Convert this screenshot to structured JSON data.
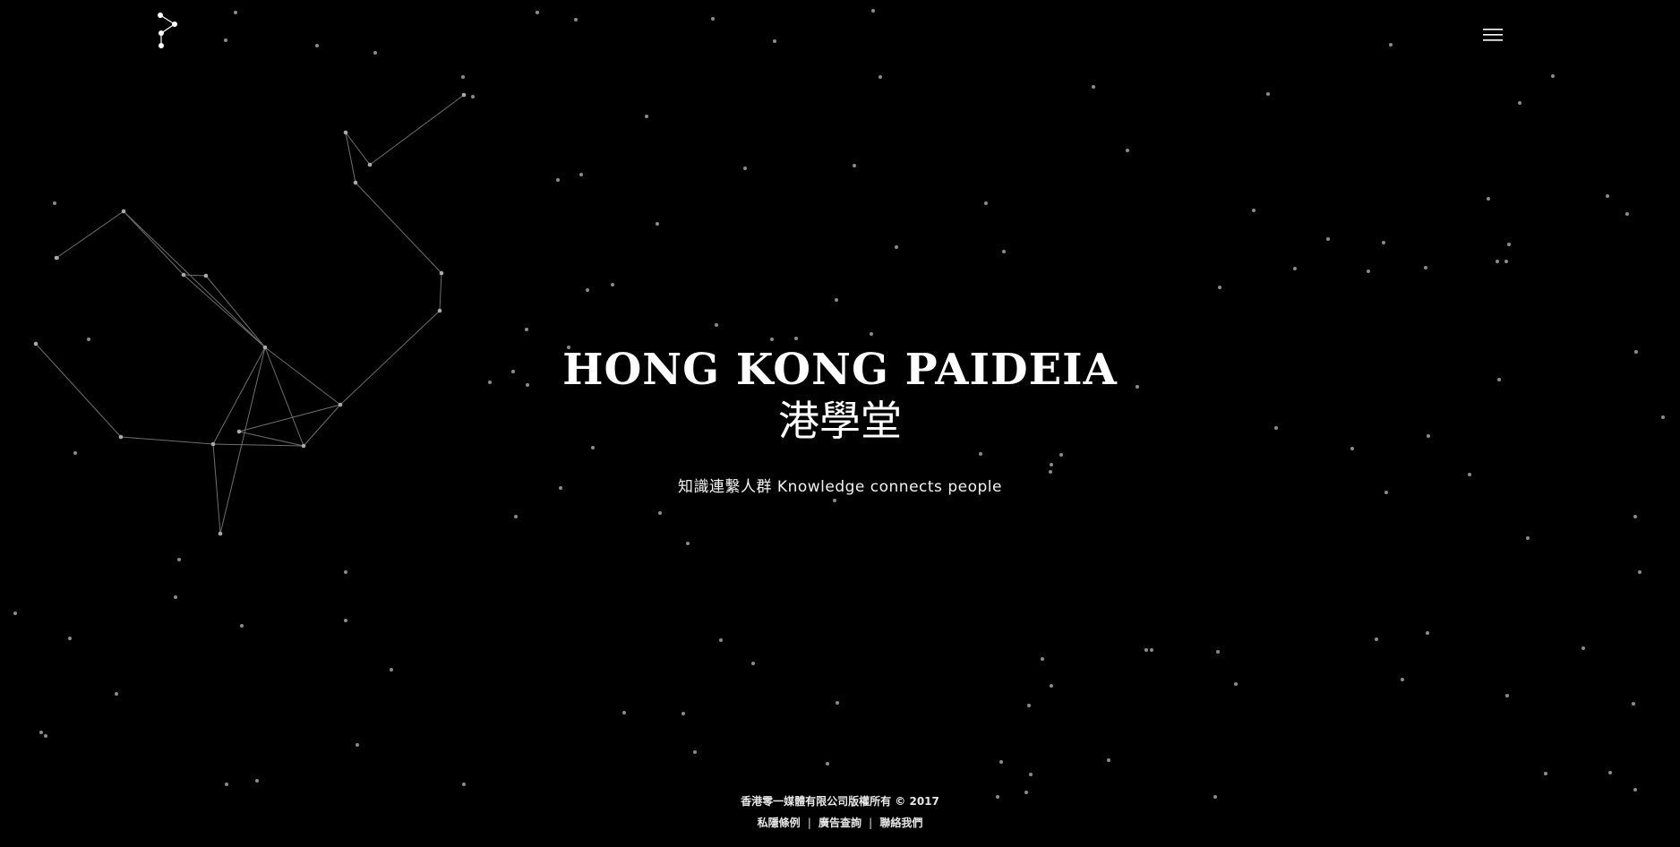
{
  "brand": {
    "logo_icon": "constellation-logo-icon",
    "menu_icon": "hamburger-menu-icon"
  },
  "hero": {
    "title": "HONG KONG PAIDEIA",
    "subtitle_cn": "港學堂",
    "tagline": "知識連繫人群 Knowledge connects people"
  },
  "footer": {
    "copyright": "香港零一媒體有限公司版權所有 © 2017",
    "links": [
      {
        "label": "私隱條例"
      },
      {
        "label": "廣告查詢"
      },
      {
        "label": "聯絡我們"
      }
    ],
    "separator": "|"
  },
  "colors": {
    "background": "#000000",
    "text": "#ffffff",
    "star": "#8a8a8a",
    "line": "#6e6e6e"
  }
}
